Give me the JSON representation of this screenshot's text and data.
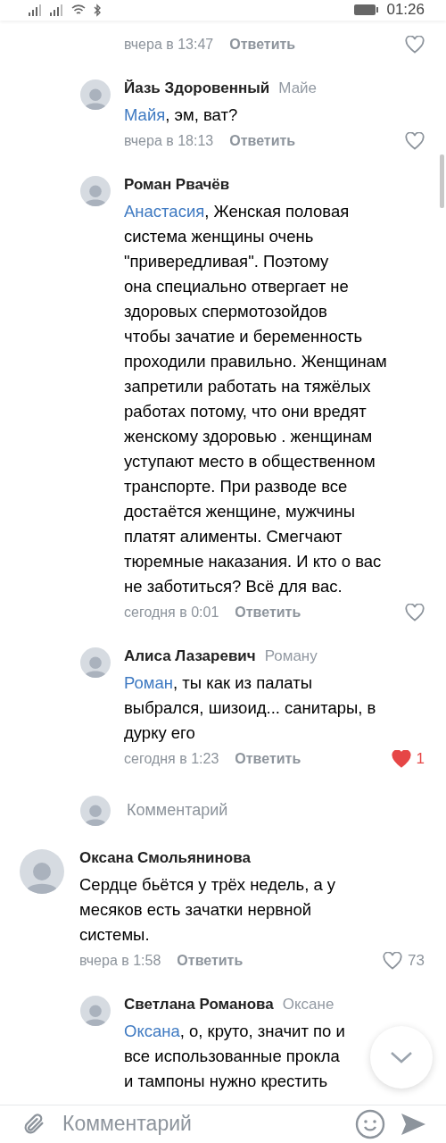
{
  "status_bar": {
    "time": "01:26"
  },
  "comments": [
    {
      "kind": "reply",
      "time": "вчера в 13:47",
      "reply_label": "Ответить",
      "likes": {
        "liked": false
      }
    },
    {
      "kind": "reply",
      "author": "Йазь Здоровенный",
      "reply_to": "Майе",
      "mention": "Майя",
      "text": ", эм, ват?",
      "time": "вчера в 18:13",
      "reply_label": "Ответить",
      "likes": {
        "liked": false
      }
    },
    {
      "kind": "reply",
      "author": "Роман Рвачёв",
      "mention": "Анастасия",
      "text": ", Женская половая\nсистема женщины очень\n\"привередливая\". Поэтому\nона специально отвергает не\nздоровых спермотозойдов\nчтобы зачатие и беременность\nпроходили правильно. Женщинам\nзапретили работать на тяжёлых\nработах потому, что они вредят\nженскому здоровью .  женщинам\nуступают место в общественном\nтранспорте. При разводе все\nдостаётся женщине, мужчины\nплатят алименты. Смегчают\nтюремные наказания. И кто о вас\nне заботиться? Всё для вас.",
      "time": "сегодня в 0:01",
      "reply_label": "Ответить",
      "likes": {
        "liked": false
      }
    },
    {
      "kind": "reply",
      "author": "Алиса Лазаревич",
      "reply_to": "Роману",
      "mention": "Роман",
      "text": ", ты как из палаты\nвыбрался, шизоид... санитары, в\nдурку его",
      "time": "сегодня в 1:23",
      "reply_label": "Ответить",
      "likes": {
        "liked": true,
        "count": "1"
      }
    },
    {
      "kind": "reply_input",
      "placeholder": "Комментарий"
    },
    {
      "kind": "comment",
      "author": "Оксана Смольянинова",
      "text": "Сердце бьётся у трёх недель, а у\nмесяков есть зачатки нервной\nсистемы.",
      "time": "вчера в 1:58",
      "reply_label": "Ответить",
      "likes": {
        "liked": false,
        "count": "73"
      }
    },
    {
      "kind": "reply",
      "author": "Светлана Романова",
      "reply_to": "Оксане",
      "mention": "Оксана",
      "text": ", о, круто,  значит по и\nвсе использованные прокла\nи тампоны нужно крестить"
    }
  ],
  "composer": {
    "placeholder": "Комментарий"
  }
}
